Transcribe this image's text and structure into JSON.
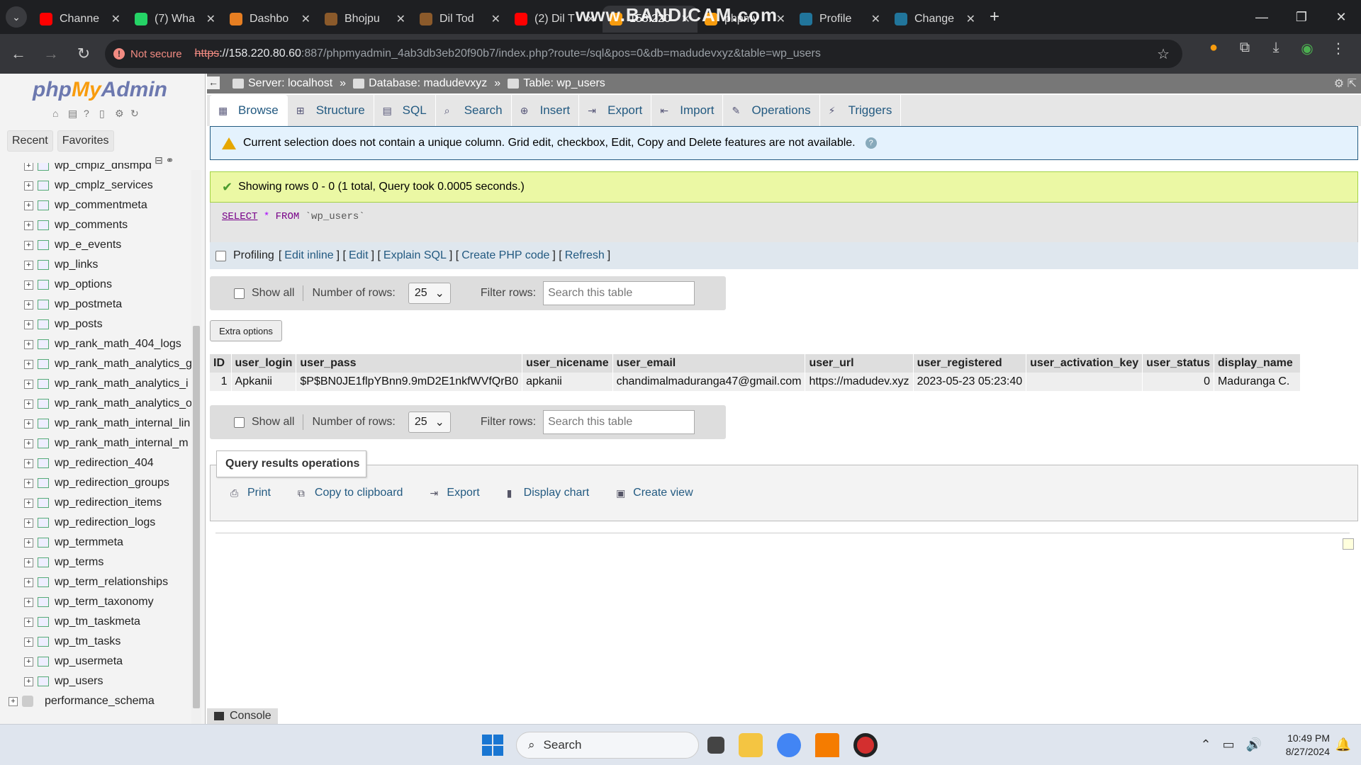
{
  "browser": {
    "tabs": [
      {
        "title": "Channe",
        "favicon_color": "#ff0000"
      },
      {
        "title": "(7) Wha",
        "favicon_color": "#25d366"
      },
      {
        "title": "Dashbo",
        "favicon_color": "#e67e22"
      },
      {
        "title": "Bhojpu",
        "favicon_color": "#8b5a2b"
      },
      {
        "title": "Dil Tod",
        "favicon_color": "#8b5a2b"
      },
      {
        "title": "(2) Dil T",
        "favicon_color": "#ff0000"
      },
      {
        "title": "158.220",
        "favicon_color": "#f89c0e",
        "active": true
      },
      {
        "title": "phpmy",
        "favicon_color": "#f89c0e"
      },
      {
        "title": "Profile",
        "favicon_color": "#21759b"
      },
      {
        "title": "Change",
        "favicon_color": "#21759b"
      }
    ],
    "watermark": "www.BANDICAM.com",
    "security_label": "Not secure",
    "url_scheme": "https",
    "url_host": "://158.220.80.60",
    "url_rest": ":887/phpmyadmin_4ab3db3eb20f90b7/index.php?route=/sql&pos=0&db=madudevxyz&table=wp_users"
  },
  "sidebar": {
    "logo_php": "php",
    "logo_my": "My",
    "logo_admin": "Admin",
    "tab_recent": "Recent",
    "tab_favorites": "Favorites",
    "tables": [
      "wp_cmplz_dnsmpd",
      "wp_cmplz_services",
      "wp_commentmeta",
      "wp_comments",
      "wp_e_events",
      "wp_links",
      "wp_options",
      "wp_postmeta",
      "wp_posts",
      "wp_rank_math_404_logs",
      "wp_rank_math_analytics_g",
      "wp_rank_math_analytics_i",
      "wp_rank_math_analytics_o",
      "wp_rank_math_internal_lin",
      "wp_rank_math_internal_m",
      "wp_redirection_404",
      "wp_redirection_groups",
      "wp_redirection_items",
      "wp_redirection_logs",
      "wp_termmeta",
      "wp_terms",
      "wp_term_relationships",
      "wp_term_taxonomy",
      "wp_tm_taskmeta",
      "wp_tm_tasks",
      "wp_usermeta",
      "wp_users"
    ],
    "db_performance": "performance_schema"
  },
  "breadcrumb": {
    "server": "Server: localhost",
    "database": "Database: madudevxyz",
    "table": "Table: wp_users",
    "sep": "»"
  },
  "menu": {
    "browse": "Browse",
    "structure": "Structure",
    "sql": "SQL",
    "search": "Search",
    "insert": "Insert",
    "export": "Export",
    "import": "Import",
    "operations": "Operations",
    "triggers": "Triggers"
  },
  "notice": "Current selection does not contain a unique column. Grid edit, checkbox, Edit, Copy and Delete features are not available.",
  "success": "Showing rows 0 - 0 (1 total, Query took 0.0005 seconds.)",
  "sql": {
    "select": "SELECT",
    "star": "*",
    "from": "FROM",
    "table": "`wp_users`"
  },
  "profiling": {
    "label": "Profiling",
    "edit_inline": "Edit inline",
    "edit": "Edit",
    "explain": "Explain SQL",
    "php": "Create PHP code",
    "refresh": "Refresh"
  },
  "nav": {
    "show_all": "Show all",
    "rows_label": "Number of rows:",
    "rows_value": "25",
    "filter_label": "Filter rows:",
    "filter_placeholder": "Search this table"
  },
  "extra_options": "Extra options",
  "columns": [
    "ID",
    "user_login",
    "user_pass",
    "user_nicename",
    "user_email",
    "user_url",
    "user_registered",
    "user_activation_key",
    "user_status",
    "display_name"
  ],
  "row": {
    "id": "1",
    "user_login": "Apkanii",
    "user_pass": "$P$BN0JE1flpYBnn9.9mD2E1nkfWVfQrB0",
    "user_nicename": "apkanii",
    "user_email": "chandimalmaduranga47@gmail.com",
    "user_url": "https://madudev.xyz",
    "user_registered": "2023-05-23 05:23:40",
    "user_activation_key": "",
    "user_status": "0",
    "display_name": "Maduranga C."
  },
  "qro": {
    "title": "Query results operations",
    "print": "Print",
    "copy": "Copy to clipboard",
    "export": "Export",
    "chart": "Display chart",
    "view": "Create view"
  },
  "console": "Console",
  "taskbar": {
    "search": "Search",
    "time": "10:49 PM",
    "date": "8/27/2024"
  }
}
